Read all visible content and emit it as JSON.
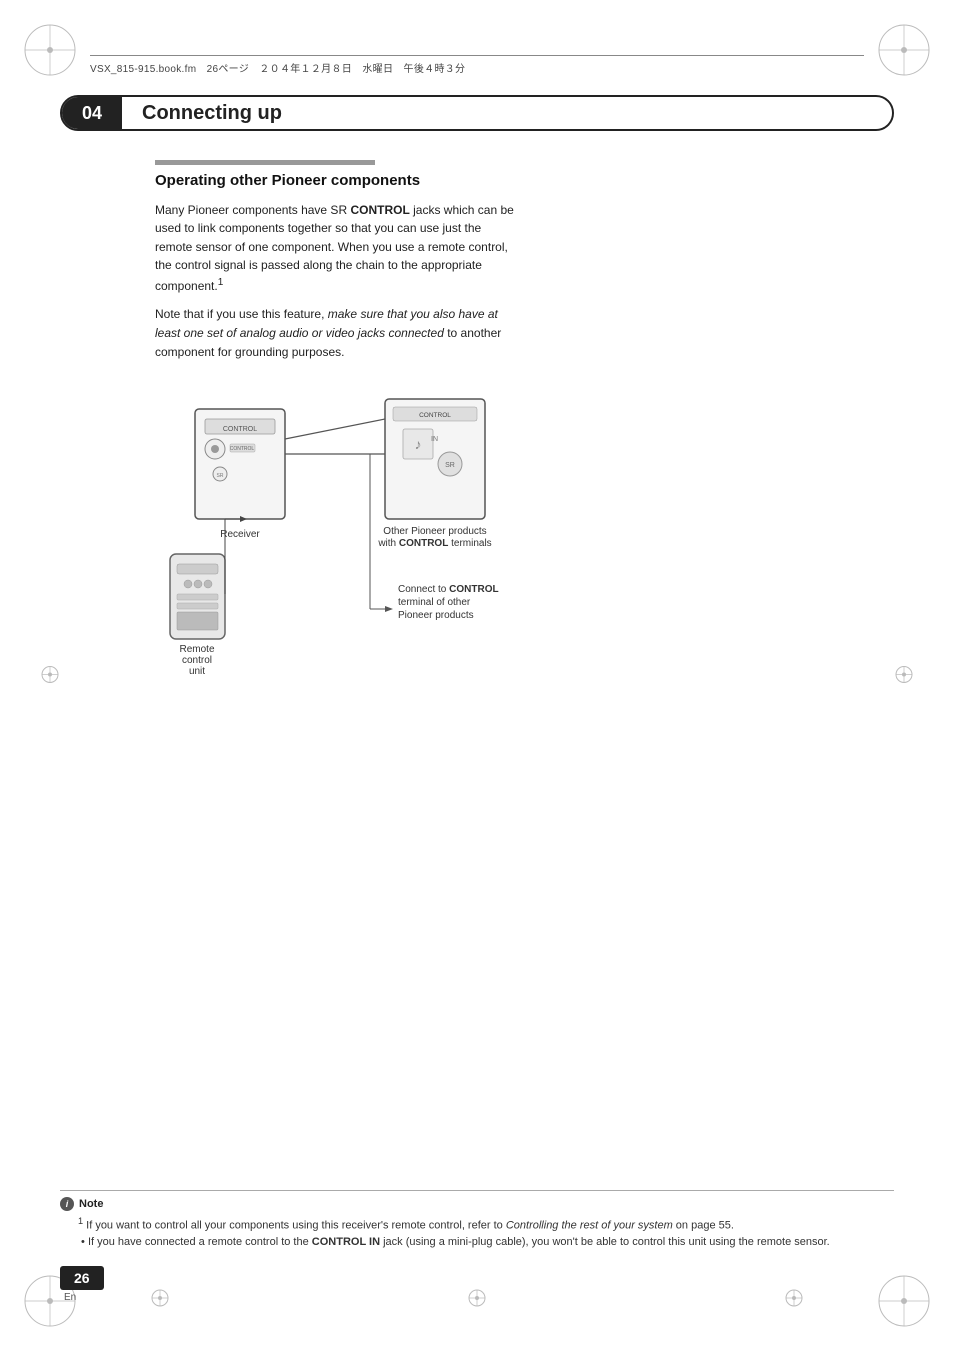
{
  "meta_bar": {
    "text": "VSX_815-915.book.fm　26ページ　２０４年１２月８日　水曜日　午後４時３分"
  },
  "chapter": {
    "number": "04",
    "title": "Connecting up"
  },
  "section": {
    "title": "Operating other Pioneer components",
    "body1": "Many Pioneer components have SR CONTROL jacks which can be used to link components together so that you can use just the remote sensor of one component. When you use a remote control, the control signal is passed along the chain to the appropriate component.¹",
    "body2": "Note that if you use this feature, make sure that you also have at least one set of analog audio or video jacks connected to another component for grounding purposes."
  },
  "diagram": {
    "labels": {
      "receiver": "Receiver",
      "remote": "Remote\ncontrol\nunit",
      "other_products": "Other Pioneer products\nwith CONTROL terminals",
      "connect_to": "Connect to CONTROL\nterminal of other\nPioneer products"
    }
  },
  "footnote": {
    "title": "Note",
    "line1": "• If you want to control all your components using this receiver's remote control, refer to Controlling the rest of your system on page 55.",
    "line2": "• If you have connected a remote control to the CONTROL IN jack (using a mini-plug cable), you won't be able to control this unit using the remote sensor."
  },
  "page": {
    "number": "26",
    "lang": "En"
  }
}
